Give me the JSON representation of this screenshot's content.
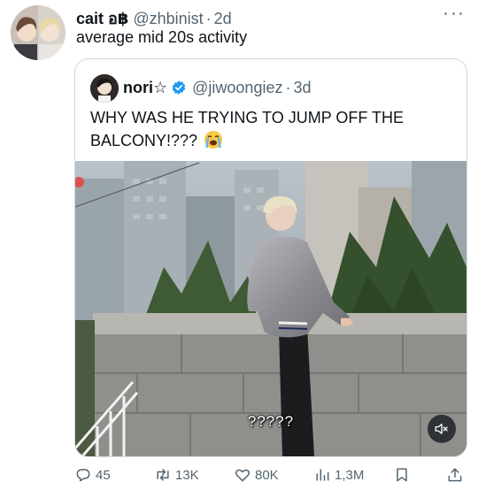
{
  "tweet": {
    "author_name": "cait อ฿",
    "author_handle": "@zhbinist",
    "dot": "·",
    "time": "2d",
    "text": "average mid 20s activity"
  },
  "quoted": {
    "author_name": "nori☆",
    "author_handle": "@jiwoongiez",
    "dot": "·",
    "time": "3d",
    "text": "WHY WAS HE TRYING TO JUMP OFF THE BALCONY!???",
    "verified_color": "#1d9bf0",
    "media": {
      "caption": "?????",
      "mute_icon": "speaker-muted-icon"
    }
  },
  "actions": {
    "replies": "45",
    "reposts": "13K",
    "likes": "80K",
    "views": "1,3M"
  },
  "colors": {
    "text": "#0f1419",
    "secondary": "#536471",
    "border": "#cfd9de",
    "accent": "#1d9bf0"
  }
}
